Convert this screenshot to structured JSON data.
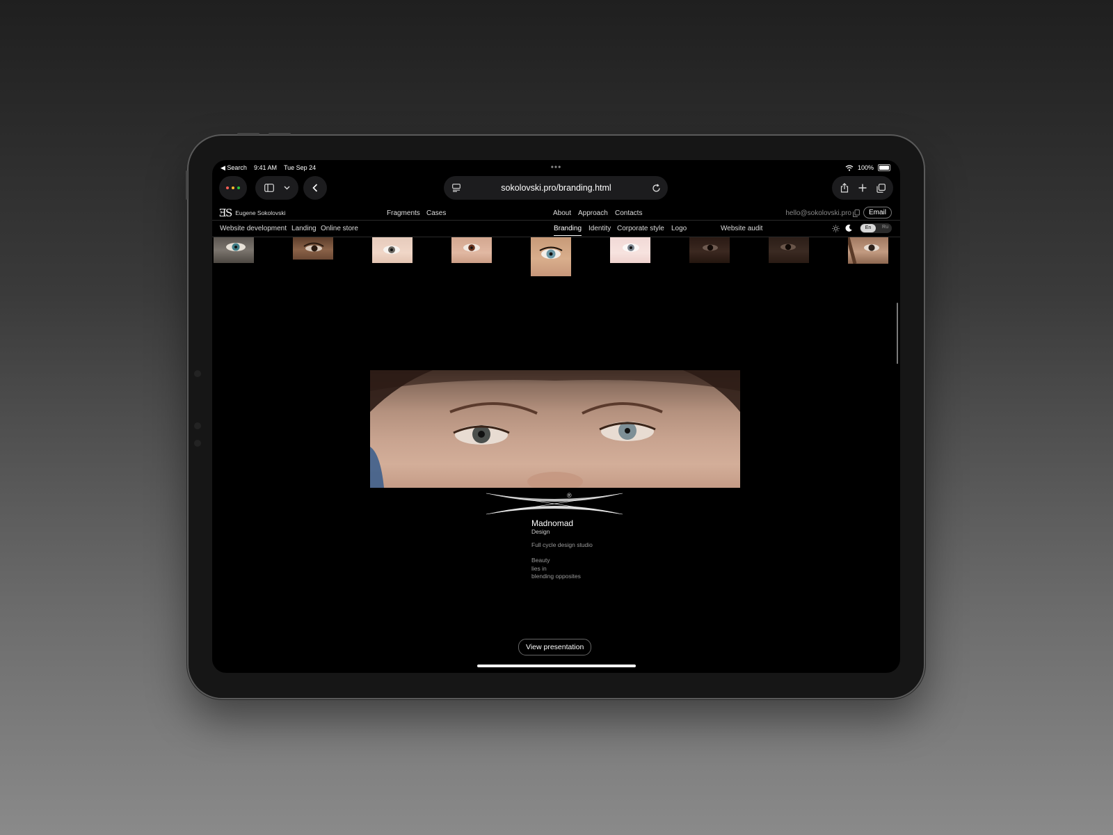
{
  "status_bar": {
    "back_app": "◀ Search",
    "time": "9:41 AM",
    "date": "Tue Sep 24",
    "battery": "100%"
  },
  "browser": {
    "url": "sokolovski.pro/branding.html"
  },
  "site": {
    "logo_mark": "ƎS",
    "owner_name": "Eugene Sokolovski",
    "nav_primary": [
      "Fragments",
      "Cases"
    ],
    "nav_secondary": [
      "About",
      "Approach",
      "Contacts"
    ],
    "email_address": "hello@sokolovski.pro",
    "email_button": "Email",
    "subnav_left": [
      "Website development",
      "Landing",
      "Online store"
    ],
    "subnav_right": [
      "Branding",
      "Identity",
      "Corporate style",
      "Logo"
    ],
    "subnav_active": "Branding",
    "website_audit": "Website audit",
    "lang": {
      "en": "En",
      "ru": "Ru",
      "active": "En"
    }
  },
  "project": {
    "title": "Madnomad",
    "subtitle": "Design",
    "description": "Full cycle design studio",
    "quote": [
      "Beauty",
      "lies in",
      "blending opposites"
    ],
    "registered_mark": "®",
    "cta": "View presentation"
  },
  "icons": [
    "wifi-icon",
    "battery-icon",
    "sidebar-icon",
    "chevron-down-icon",
    "back-arrow-icon",
    "page-menu-icon",
    "reload-icon",
    "share-icon",
    "plus-icon",
    "tabs-icon",
    "copy-icon",
    "sun-icon",
    "moon-icon"
  ]
}
